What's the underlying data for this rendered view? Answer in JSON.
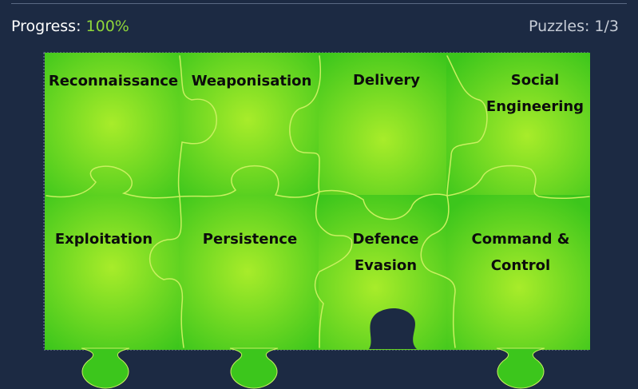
{
  "header": {
    "progress_label": "Progress:",
    "progress_value": "100%",
    "puzzles_label": "Puzzles: 1/3"
  },
  "puzzle": {
    "completion_fraction": 1.0,
    "pieces": [
      {
        "id": "reconnaissance",
        "lines": [
          "Reconnaissance"
        ]
      },
      {
        "id": "weaponisation",
        "lines": [
          "Weaponisation"
        ]
      },
      {
        "id": "delivery",
        "lines": [
          "Delivery"
        ]
      },
      {
        "id": "social-engineering",
        "lines": [
          "Social",
          "Engineering"
        ]
      },
      {
        "id": "exploitation",
        "lines": [
          "Exploitation"
        ]
      },
      {
        "id": "persistence",
        "lines": [
          "Persistence"
        ]
      },
      {
        "id": "defence-evasion",
        "lines": [
          "Defence",
          "Evasion"
        ]
      },
      {
        "id": "command-control",
        "lines": [
          "Command &",
          "Control"
        ]
      }
    ]
  },
  "colors": {
    "background": "#1c2a43",
    "piece_center": "#a8ec2a",
    "piece_edge": "#3cc61c",
    "piece_seam": "#c8f060",
    "progress_accent": "#8fd63a"
  }
}
